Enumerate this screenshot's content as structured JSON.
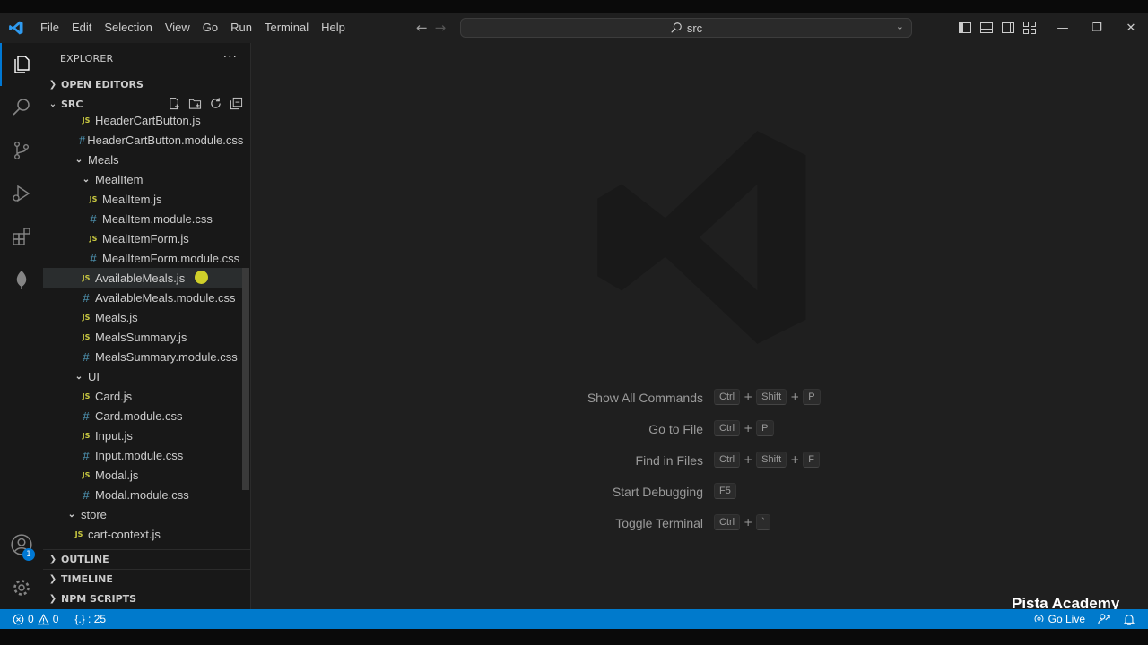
{
  "titlebar": {
    "menu": [
      "File",
      "Edit",
      "Selection",
      "View",
      "Go",
      "Run",
      "Terminal",
      "Help"
    ],
    "search_text": "src"
  },
  "activity": {
    "accounts_badge": "1"
  },
  "explorer": {
    "title": "EXPLORER",
    "open_editors": "OPEN EDITORS",
    "root": "SRC",
    "items": [
      {
        "label": "HeaderCartButton.js",
        "type": "js"
      },
      {
        "label": "HeaderCartButton.module.css",
        "type": "css"
      },
      {
        "label": "Meals",
        "type": "folder"
      },
      {
        "label": "MealItem",
        "type": "folder"
      },
      {
        "label": "MealItem.js",
        "type": "js"
      },
      {
        "label": "MealItem.module.css",
        "type": "css"
      },
      {
        "label": "MealItemForm.js",
        "type": "js"
      },
      {
        "label": "MealItemForm.module.css",
        "type": "css"
      },
      {
        "label": "AvailableMeals.js",
        "type": "js"
      },
      {
        "label": "AvailableMeals.module.css",
        "type": "css"
      },
      {
        "label": "Meals.js",
        "type": "js"
      },
      {
        "label": "MealsSummary.js",
        "type": "js"
      },
      {
        "label": "MealsSummary.module.css",
        "type": "css"
      },
      {
        "label": "UI",
        "type": "folder"
      },
      {
        "label": "Card.js",
        "type": "js"
      },
      {
        "label": "Card.module.css",
        "type": "css"
      },
      {
        "label": "Input.js",
        "type": "js"
      },
      {
        "label": "Input.module.css",
        "type": "css"
      },
      {
        "label": "Modal.js",
        "type": "js"
      },
      {
        "label": "Modal.module.css",
        "type": "css"
      },
      {
        "label": "store",
        "type": "folder"
      },
      {
        "label": "cart-context.js",
        "type": "js"
      }
    ],
    "js_glyph": "JS",
    "css_glyph": "#",
    "outline": "OUTLINE",
    "timeline": "TIMELINE",
    "npm_scripts": "NPM SCRIPTS"
  },
  "editor": {
    "shortcuts": [
      {
        "label": "Show All Commands",
        "keys": [
          "Ctrl",
          "Shift",
          "P"
        ]
      },
      {
        "label": "Go to File",
        "keys": [
          "Ctrl",
          "P"
        ]
      },
      {
        "label": "Find in Files",
        "keys": [
          "Ctrl",
          "Shift",
          "F"
        ]
      },
      {
        "label": "Start Debugging",
        "keys": [
          "F5"
        ]
      },
      {
        "label": "Toggle Terminal",
        "keys": [
          "Ctrl",
          "`"
        ]
      }
    ],
    "brand": "Pista Academy"
  },
  "statusbar": {
    "errors": "0",
    "warnings": "0",
    "cursor": "{.} : 25",
    "go_live": "Go Live"
  },
  "colors": {
    "accent": "#007acc",
    "js": "#cbcb41",
    "css": "#519aba"
  }
}
